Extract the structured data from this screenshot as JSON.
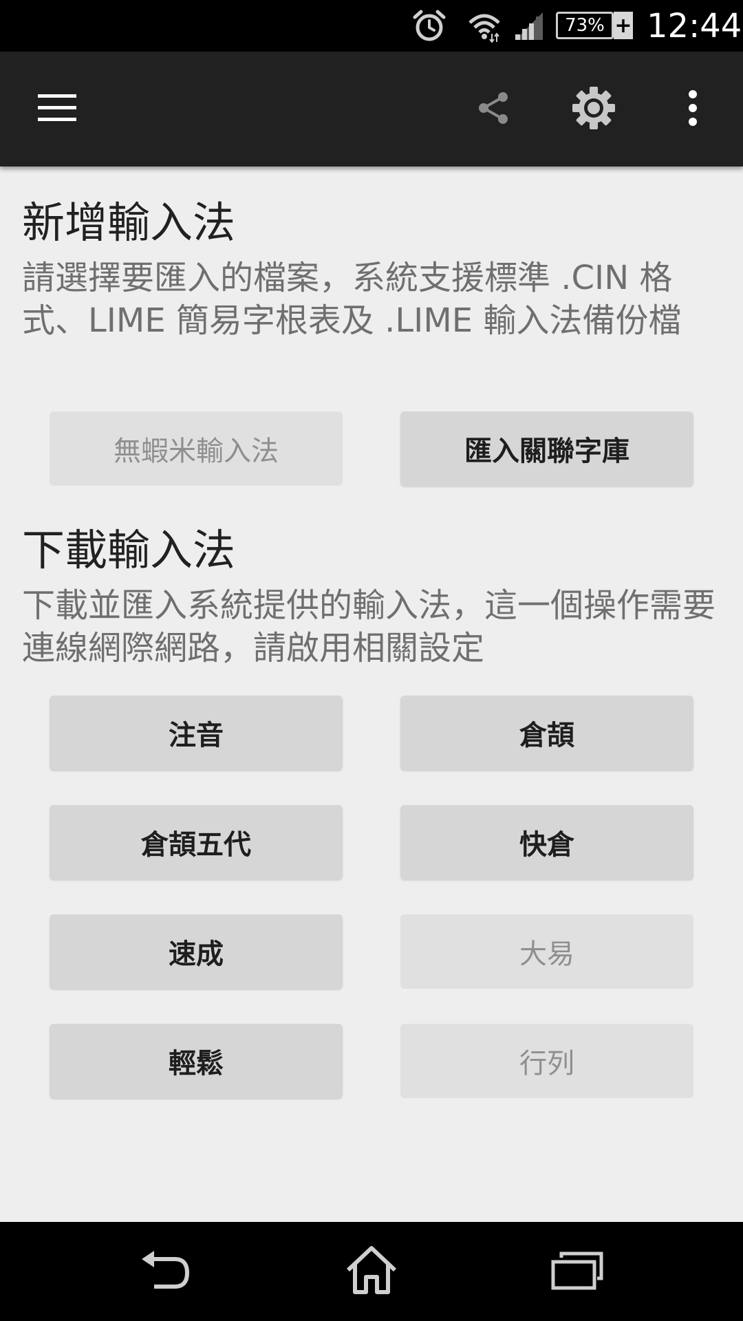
{
  "status_bar": {
    "battery_percent": "73%",
    "battery_plus": "+",
    "time": "12:44",
    "icons": [
      "alarm-icon",
      "wifi-icon",
      "signal-icon",
      "battery-icon"
    ]
  },
  "action_bar": {
    "icons": [
      "menu-icon",
      "share-icon",
      "settings-icon",
      "more-vert-icon"
    ]
  },
  "add_section": {
    "title": "新增輸入法",
    "description": "請選擇要匯入的檔案，系統支援標準 .CIN 格式、LIME 簡易字根表及 .LIME 輸入法備份檔",
    "buttons": [
      {
        "label": "無蝦米輸入法",
        "enabled": false
      },
      {
        "label": "匯入關聯字庫",
        "enabled": true
      }
    ]
  },
  "download_section": {
    "title": "下載輸入法",
    "description": "下載並匯入系統提供的輸入法，這一個操作需要連線網際網路，請啟用相關設定",
    "buttons": [
      {
        "label": "注音",
        "enabled": true
      },
      {
        "label": "倉頡",
        "enabled": true
      },
      {
        "label": "倉頡五代",
        "enabled": true
      },
      {
        "label": "快倉",
        "enabled": true
      },
      {
        "label": "速成",
        "enabled": true
      },
      {
        "label": "大易",
        "enabled": false
      },
      {
        "label": "輕鬆",
        "enabled": true
      },
      {
        "label": "行列",
        "enabled": false
      }
    ]
  },
  "nav_bar": {
    "icons": [
      "back-icon",
      "home-icon",
      "recent-apps-icon"
    ]
  }
}
